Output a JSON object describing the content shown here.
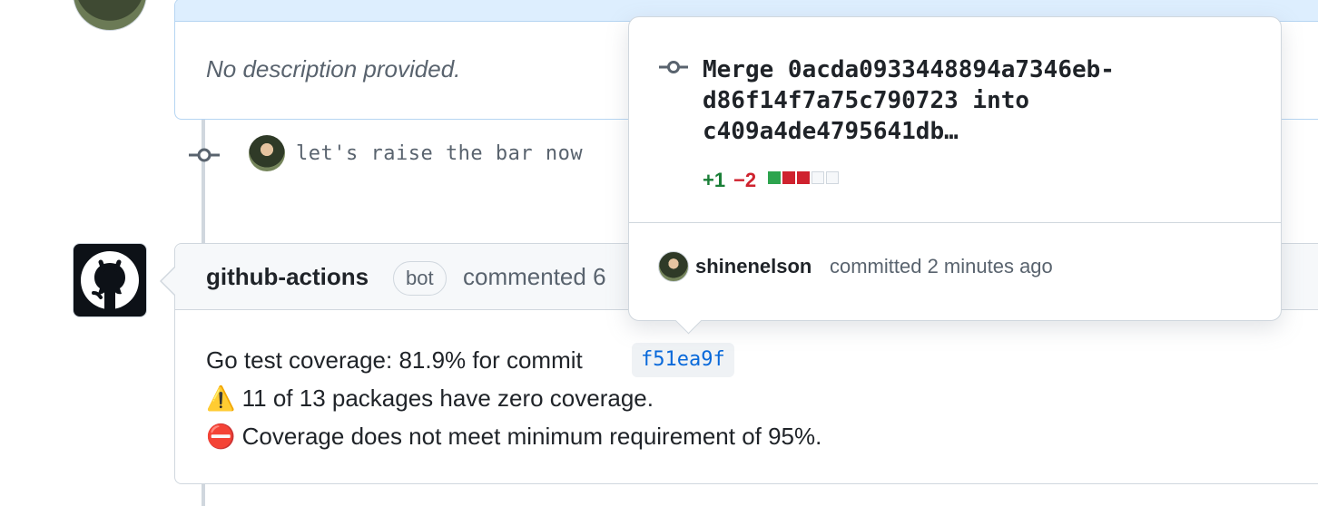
{
  "pr": {
    "description": "No description provided."
  },
  "commit": {
    "message": "let's raise the bar now"
  },
  "comment": {
    "author": "github-actions",
    "badge": "bot",
    "action": "commented 6",
    "line1_text": "Go test coverage: 81.9% for commit",
    "commit_sha": "f51ea9f",
    "line2_icon": "⚠️",
    "line2_text": "11 of 13 packages have zero coverage.",
    "line3_icon": "⛔",
    "line3_text": "Coverage does not meet minimum requirement of 95%."
  },
  "popover": {
    "title_line1": "Merge 0acda0933448894a7346eb-",
    "title_line2": "d86f14f7a75c790723 into",
    "title_line3": "c409a4de4795641db…",
    "additions": "+1",
    "deletions": "−2",
    "diffstat_blocks": [
      "add",
      "del",
      "del",
      "neutral",
      "neutral"
    ],
    "user": "shinenelson",
    "meta": "committed 2 minutes ago"
  },
  "colors": {
    "link": "#0969da",
    "add": "#1a7f37",
    "delete": "#cf222e",
    "muted": "#59636e"
  }
}
